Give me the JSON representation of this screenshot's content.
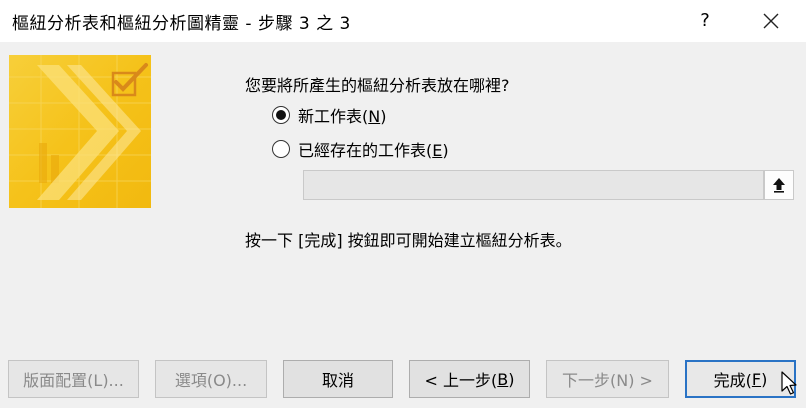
{
  "dialog": {
    "title": "樞紐分析表和樞紐分析圖精靈 - 步驟 3 之 3",
    "help": "?"
  },
  "question": "您要將所產生的樞紐分析表放在哪裡?",
  "options": {
    "new_sheet": {
      "label": "新工作表(",
      "key": "N",
      "suffix": ")",
      "selected": true
    },
    "existing_sheet": {
      "label": "已經存在的工作表(",
      "key": "E",
      "suffix": ")",
      "selected": false
    }
  },
  "range_input": {
    "value": ""
  },
  "info_text": "按一下 [完成] 按鈕即可開始建立樞紐分析表。",
  "buttons": {
    "layout": "版面配置(L)...",
    "options": "選項(O)...",
    "cancel": "取消",
    "back_prefix": "< 上一步(",
    "back_key": "B",
    "back_suffix": ")",
    "next": "下一步(N) >",
    "finish_prefix": "完成(",
    "finish_key": "F",
    "finish_suffix": ")"
  },
  "colors": {
    "accent": "#2a73c5",
    "wizard_graphic": "#f5c21a"
  }
}
